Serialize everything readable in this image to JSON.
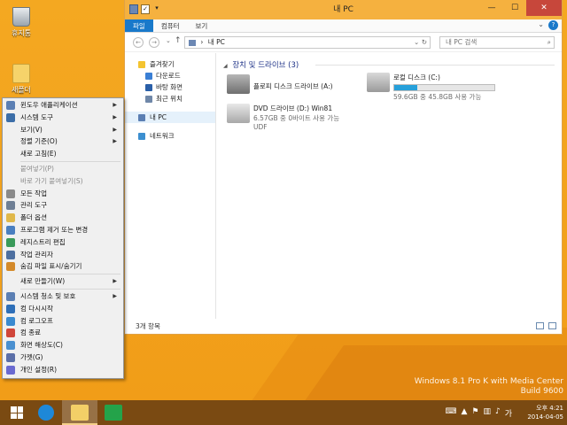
{
  "desktop": {
    "icons": [
      {
        "label": "휴지통"
      },
      {
        "label": "새폴더"
      }
    ]
  },
  "context_menu": {
    "items": [
      {
        "label": "윈도우 애플리케이션",
        "has_submenu": true,
        "disabled": false
      },
      {
        "label": "시스템 도구",
        "has_submenu": true,
        "disabled": false
      },
      {
        "label": "보기(V)",
        "has_submenu": true,
        "disabled": false
      },
      {
        "label": "정렬 기준(O)",
        "has_submenu": true,
        "disabled": false
      },
      {
        "label": "새로 고침(E)",
        "has_submenu": false,
        "disabled": false
      },
      {
        "separator": true
      },
      {
        "label": "붙여넣기(P)",
        "has_submenu": false,
        "disabled": true
      },
      {
        "label": "바로 가기 붙여넣기(S)",
        "has_submenu": false,
        "disabled": true
      },
      {
        "label": "모든 작업",
        "has_submenu": false,
        "disabled": false
      },
      {
        "label": "관리 도구",
        "has_submenu": false,
        "disabled": false
      },
      {
        "label": "폴더 옵션",
        "has_submenu": false,
        "disabled": false
      },
      {
        "label": "프로그램 제거 또는 변경",
        "has_submenu": false,
        "disabled": false
      },
      {
        "label": "레지스트리 편집",
        "has_submenu": false,
        "disabled": false
      },
      {
        "label": "작업 관리자",
        "has_submenu": false,
        "disabled": false
      },
      {
        "label": "숨김 파일 표시/숨기기",
        "has_submenu": false,
        "disabled": false
      },
      {
        "separator": true
      },
      {
        "label": "새로 만들기(W)",
        "has_submenu": true,
        "disabled": false
      },
      {
        "separator": true
      },
      {
        "label": "시스템 청소 및 보호",
        "has_submenu": true,
        "disabled": false
      },
      {
        "label": "컴 다시시작",
        "has_submenu": false,
        "disabled": false
      },
      {
        "label": "컴 로그오프",
        "has_submenu": false,
        "disabled": false
      },
      {
        "label": "컴 종료",
        "has_submenu": false,
        "disabled": false
      },
      {
        "label": "화면 해상도(C)",
        "has_submenu": false,
        "disabled": false
      },
      {
        "label": "가젯(G)",
        "has_submenu": false,
        "disabled": false
      },
      {
        "label": "개인 설정(R)",
        "has_submenu": false,
        "disabled": false
      }
    ]
  },
  "explorer": {
    "title": "내 PC",
    "qat": [
      "✓",
      "▾"
    ],
    "tabs": [
      "파일",
      "컴퓨터",
      "보기"
    ],
    "address": "내 PC",
    "address_path_sep": "›",
    "search_placeholder": "내 PC 검색",
    "nav": {
      "favorites": "즐겨찾기",
      "downloads": "다운로드",
      "desktop": "바탕 화면",
      "recent": "최근 위치",
      "this_pc": "내 PC",
      "network": "네트워크"
    },
    "group_header": "장치 및 드라이브 (3)",
    "drives": [
      {
        "name": "플로피 디스크 드라이브 (A:)",
        "line2": "",
        "line3": ""
      },
      {
        "name": "로컬 디스크 (C:)",
        "line2": "59.6GB 중 45.8GB 사용 가능",
        "line3": "",
        "used_fraction": 0.23
      },
      {
        "name": "DVD 드라이브 (D:) Win81",
        "line2": "6.57GB 중 0바이트 사용 가능",
        "line3": "UDF"
      }
    ],
    "status": "3개 항목"
  },
  "watermark": {
    "line1": "Windows 8.1 Pro K with Media Center",
    "line2": "Build 9600"
  },
  "taskbar": {
    "time": "오후 4:21",
    "date": "2014-04-05",
    "tray_icons": [
      "keyboard-icon",
      "chevron-up-icon",
      "flag-icon",
      "network-icon",
      "volume-icon",
      "ime-icon"
    ]
  }
}
